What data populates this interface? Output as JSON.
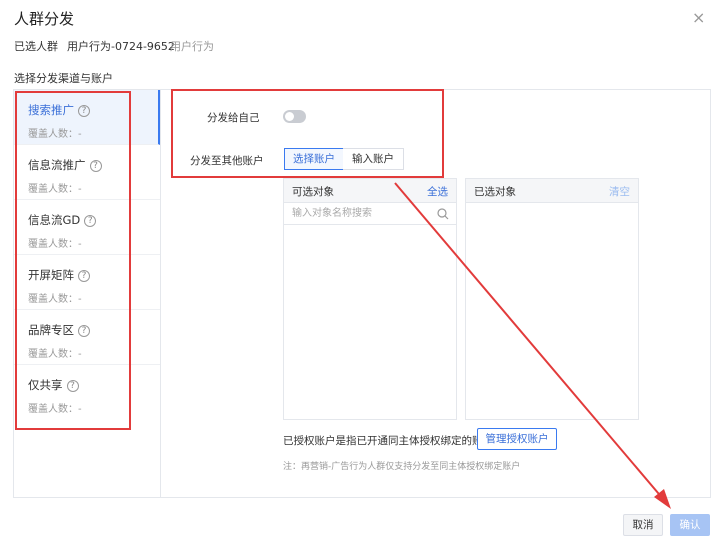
{
  "dialog": {
    "title": "人群分发",
    "close_glyph": "×"
  },
  "selected": {
    "label": "已选人群",
    "crowd": "用户行为-0724-9652",
    "crowd_type": "用户行为"
  },
  "section_label": "选择分发渠道与账户",
  "channels": [
    {
      "name": "搜索推广",
      "coverage": "覆盖人数：-",
      "active": true
    },
    {
      "name": "信息流推广",
      "coverage": "覆盖人数：-",
      "active": false
    },
    {
      "name": "信息流GD",
      "coverage": "覆盖人数：-",
      "active": false
    },
    {
      "name": "开屏矩阵",
      "coverage": "覆盖人数：-",
      "active": false
    },
    {
      "name": "品牌专区",
      "coverage": "覆盖人数：-",
      "active": false
    },
    {
      "name": "仅共享",
      "coverage": "覆盖人数：-",
      "active": false
    }
  ],
  "help_glyph": "?",
  "distribute_self": {
    "label": "分发给自己",
    "enabled": false
  },
  "distribute_others": {
    "label": "分发至其他账户",
    "options": [
      "选择账户",
      "输入账户"
    ],
    "selected": "选择账户"
  },
  "available_panel": {
    "title": "可选对象",
    "action": "全选",
    "search_placeholder": "输入对象名称搜索"
  },
  "selected_panel": {
    "title": "已选对象",
    "action": "清空"
  },
  "auth": {
    "text": "已授权账户是指已开通同主体授权绑定的账户",
    "button": "管理授权账户",
    "note": "注：再营销-广告行为人群仅支持分发至同主体授权绑定账户"
  },
  "footer": {
    "cancel": "取消",
    "confirm": "确认"
  },
  "colors": {
    "accent": "#3a7af0",
    "annotation": "#e23b3b",
    "confirm_disabled": "#a7c4f4"
  },
  "icons": {
    "search": "search-icon",
    "help": "question-circle-icon",
    "close": "close-icon"
  }
}
